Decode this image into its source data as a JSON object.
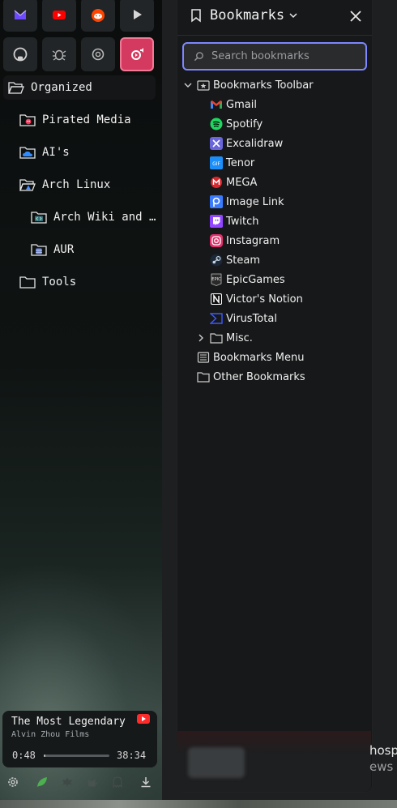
{
  "pinned_tabs": [
    {
      "name": "proton-mail-icon",
      "color": "#6d4aff"
    },
    {
      "name": "youtube-icon",
      "color": "#ff0000"
    },
    {
      "name": "reddit-icon",
      "color": "#ff4500"
    },
    {
      "name": "video-player-icon",
      "color": "#d0d0d0"
    },
    {
      "name": "github-icon",
      "color": "#d0d0d0"
    },
    {
      "name": "bug-icon",
      "color": "#b5b5b5"
    },
    {
      "name": "openai-icon",
      "color": "#b5b5b5"
    },
    {
      "name": "youtube-music-icon",
      "color": "#ffffff",
      "active": true
    }
  ],
  "sidebar": {
    "tree": [
      {
        "label": "Organized",
        "icon": "folder-open-icon"
      },
      {
        "label": "Pirated Media",
        "icon": "folder-pirate-icon"
      },
      {
        "label": "AI's",
        "icon": "folder-cloud-icon"
      },
      {
        "label": "Arch Linux",
        "icon": "folder-arch-icon"
      },
      {
        "label": "Arch Wiki and …",
        "icon": "folder-code-icon"
      },
      {
        "label": "AUR",
        "icon": "folder-grid-icon"
      },
      {
        "label": "Tools",
        "icon": "folder-icon"
      }
    ]
  },
  "media": {
    "title": "The Most Legendary",
    "artist": "Alvin Zhou Films",
    "elapsed": "0:48",
    "duration": "38:34",
    "progress": 0.0207
  },
  "bottom_icons": [
    "settings-icon",
    "leaf-icon",
    "maple-leaf-icon",
    "cat-icon",
    "ghost-icon",
    "download-icon"
  ],
  "panel": {
    "title": "Bookmarks",
    "search_placeholder": "Search bookmarks",
    "accent": "#7d87ff",
    "toolbar_label": "Bookmarks Toolbar",
    "bookmarks": [
      {
        "label": "Gmail",
        "icon": "gmail-icon"
      },
      {
        "label": "Spotify",
        "icon": "spotify-icon"
      },
      {
        "label": "Excalidraw",
        "icon": "excalidraw-icon"
      },
      {
        "label": "Tenor",
        "icon": "tenor-icon"
      },
      {
        "label": "MEGA",
        "icon": "mega-icon"
      },
      {
        "label": "Image Link",
        "icon": "image-link-icon"
      },
      {
        "label": "Twitch",
        "icon": "twitch-icon"
      },
      {
        "label": "Instagram",
        "icon": "instagram-icon"
      },
      {
        "label": "Steam",
        "icon": "steam-icon"
      },
      {
        "label": "EpicGames",
        "icon": "epic-games-icon"
      },
      {
        "label": "Victor's Notion",
        "icon": "notion-icon"
      },
      {
        "label": "VirusTotal",
        "icon": "virustotal-icon"
      }
    ],
    "misc_label": "Misc.",
    "menu_label": "Bookmarks Menu",
    "other_label": "Other Bookmarks"
  },
  "background_tab": {
    "line1": "hosp",
    "line2": "ews"
  }
}
